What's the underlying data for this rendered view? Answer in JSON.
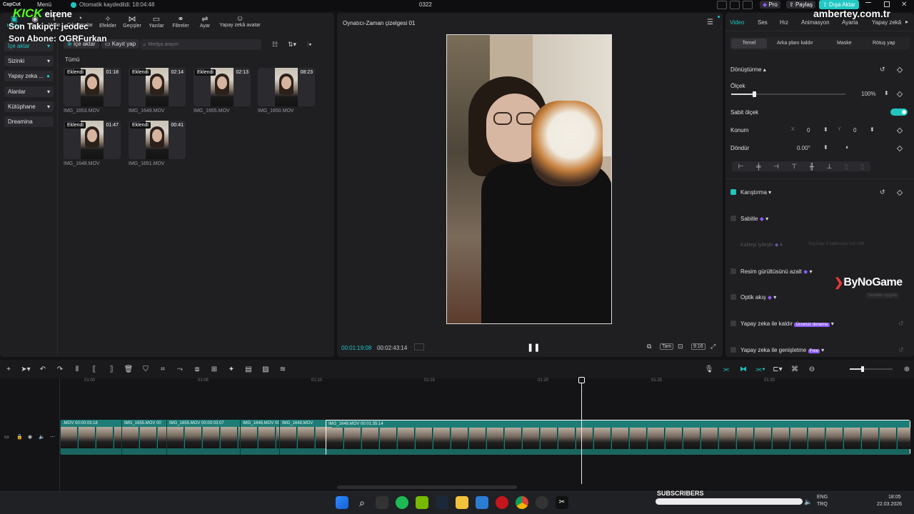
{
  "app": {
    "logo": "CapCut",
    "menu": "Menü",
    "autosave": "Otomatik kaydedildi: 18:04:48",
    "project": "0322",
    "pro": "Pro",
    "share": "Paylaş",
    "export": "Dışa Aktar"
  },
  "overlay": {
    "kick": "KICK",
    "channel": "eirene",
    "follower": "Son Takipçi: jeodec",
    "sub": "Son Abone: OGRFurkan",
    "website": "ambertey.com.tr",
    "brand": "ByNoGame",
    "subscribers": "SUBSCRIBERS"
  },
  "toolbar": [
    {
      "label": "Medya",
      "icon": "media-icon"
    },
    {
      "label": "Ses",
      "icon": "audio-icon"
    },
    {
      "label": "Metin",
      "icon": "text-icon"
    },
    {
      "label": "Çıkartmalar",
      "icon": "sticker-icon"
    },
    {
      "label": "Efektler",
      "icon": "effects-icon"
    },
    {
      "label": "Geçişler",
      "icon": "transitions-icon"
    },
    {
      "label": "Yazılar",
      "icon": "captions-icon"
    },
    {
      "label": "Filtreler",
      "icon": "filters-icon"
    },
    {
      "label": "Ayar",
      "icon": "adjust-icon"
    },
    {
      "label": "Yapay zekâ avatar",
      "icon": "avatar-icon"
    }
  ],
  "sidebar": {
    "items": [
      {
        "label": "İçe aktar",
        "active": true
      },
      {
        "label": "Sizinki"
      },
      {
        "label": "Yapay zeka ..."
      },
      {
        "label": "Alanlar"
      },
      {
        "label": "Kütüphane"
      },
      {
        "label": "Dreamina"
      }
    ]
  },
  "media": {
    "import": "İçe aktar",
    "record": "Kayıt yap",
    "search_placeholder": "Medya arayın",
    "all": "Tümü",
    "added": "Eklendi",
    "items": [
      {
        "name": "IMG_1653.MOV",
        "dur": "01:18",
        "added": true
      },
      {
        "name": "IMG_1649.MOV",
        "dur": "02:14",
        "added": true
      },
      {
        "name": "IMG_1655.MOV",
        "dur": "02:13",
        "added": true
      },
      {
        "name": "IMG_1650.MOV",
        "dur": "08:23",
        "added": false
      },
      {
        "name": "IMG_1648.MOV",
        "dur": "01:47",
        "added": true
      },
      {
        "name": "IMG_1651.MOV",
        "dur": "00:41",
        "added": true
      }
    ]
  },
  "player": {
    "title": "Oynatıcı-Zaman çizelgesi 01",
    "current": "00:01:19:08",
    "total": "00:02:43:14",
    "full": "Tam",
    "ratio": "9:16"
  },
  "props": {
    "tabs": [
      "Video",
      "Ses",
      "Hız",
      "Animasyon",
      "Ayarla",
      "Yapay zekâ"
    ],
    "subtabs": [
      "Temel",
      "Arka planı kaldır",
      "Maske",
      "Rötuş yap"
    ],
    "transform": "Dönüştürme",
    "scale": "Ölçek",
    "scale_value": "100%",
    "uniform": "Sabit ölçek",
    "position": "Konum",
    "x_label": "X",
    "x": "0",
    "y_label": "Y",
    "y": "0",
    "rotate": "Döndür",
    "rotate_value": "0.00°",
    "blend": "Karıştırma",
    "stabilize": "Sabitle",
    "quality": "Kaliteyi iyileştir",
    "quality_hint": "Süpürge 4 kalitesiyle hızlı klik",
    "denoise": "Resim gürültüsünü azalt",
    "optical": "Optik akış",
    "optical_btn": "Yeniden uygula",
    "remove": "Yapay zeka ile kaldır",
    "remove_tag": "Ücretsiz deneme",
    "expand": "Yapay zeka ile genişletme",
    "expand_tag": "Free"
  },
  "timeline": {
    "ticks": [
      "01:00",
      "01:05",
      "01:10",
      "01:15",
      "01:20",
      "01:25",
      "01:30"
    ],
    "clips": [
      {
        "label": ".MOV",
        "time": "00:00:03:18"
      },
      {
        "label": "IMG_1655.MOV",
        "time": "00"
      },
      {
        "label": "IMG_1655.MOV",
        "time": "00:00:03:07"
      },
      {
        "label": "IMG_1648.MOV",
        "time": "00"
      },
      {
        "label": "IMG_1648.MOV",
        "time": ""
      },
      {
        "label": "IMG_1648.MOV",
        "time": "00:01:35:14"
      }
    ]
  },
  "tray": {
    "lang1": "ENG",
    "lang2": "TRQ",
    "time": "18:05",
    "date": "22.03.2026"
  },
  "colors": {
    "accent": "#20c5c0",
    "export": "#22c9c4",
    "pro": "#8b5cf6",
    "kick": "#53fc18",
    "clip": "#1d7d76"
  }
}
